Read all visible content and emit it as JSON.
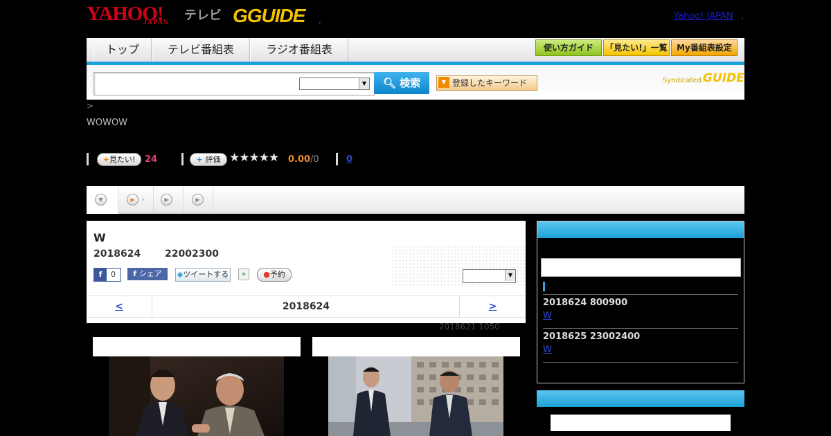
{
  "header": {
    "yahoo_logo": "YAHOO!",
    "japan_logo": "JAPAN",
    "tv_label": "テレビ",
    "gguide_logo": "GGUIDE",
    "dot": ",",
    "yahoo_japan_link": "Yahoo! JAPAN",
    "yahoo_japan_link_dot": ","
  },
  "nav": {
    "tabs": [
      "トップ",
      "テレビ番組表",
      "ラジオ番組表"
    ],
    "guide_buttons": [
      "使い方ガイド",
      "「見たい!」一覧",
      "My番組表設定"
    ]
  },
  "search": {
    "button_label": "検索",
    "keyword_button": "登録したキーワード",
    "syndicated": "Syndicated",
    "syndicated_logo": "GUIDE"
  },
  "breadcrumb": ">",
  "channel": "WOWOW",
  "stats": {
    "mitai_label": "見たい!",
    "mitai_count": "24",
    "hyoka_label": "評価",
    "stars": "★★★★★",
    "score": "0.00",
    "score_den": "/0",
    "reviews_link": "0"
  },
  "subtabs": [
    {
      "icon": "chevron-down-icon",
      "label": ""
    },
    {
      "icon": "play-icon",
      "label": ","
    },
    {
      "icon": "play-icon",
      "label": ""
    },
    {
      "icon": "play-icon",
      "label": ""
    }
  ],
  "program": {
    "title": "W",
    "date": "2018624",
    "time": "22002300",
    "fb_like_letter": "f",
    "fb_like_count": "0",
    "fb_share": "シェア",
    "tweet": "ツイートする",
    "reserve": "予約",
    "nav_prev": "<",
    "nav_date": "2018624",
    "nav_next": ">",
    "updated": "2018621  1050"
  },
  "sidebar": {
    "broadcasts": [
      {
        "date": "2018624  800900",
        "link": "W"
      },
      {
        "date": "2018625  23002400",
        "link": "W"
      }
    ]
  },
  "colors": {
    "accent_blue": "#1da1d8",
    "yahoo_red": "#d2001a",
    "gguide_yellow": "#f2c200",
    "mitai_pink": "#e0407a",
    "score_orange": "#e8872c"
  }
}
